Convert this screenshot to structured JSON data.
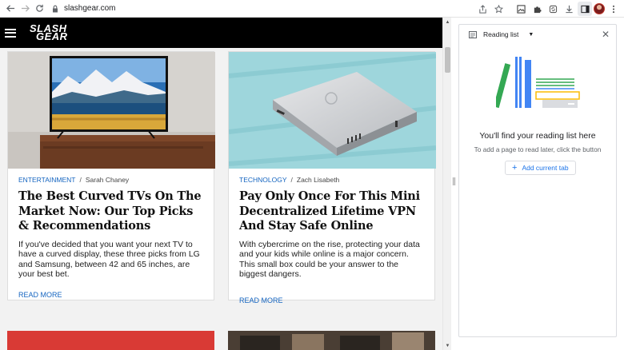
{
  "browser": {
    "url": "slashgear.com",
    "icons": [
      "back-arrow-icon",
      "forward-arrow-icon",
      "reload-icon",
      "lock-icon",
      "share-icon",
      "star-icon",
      "image-icon",
      "extensions-icon",
      "sync-icon",
      "download-icon",
      "side-panel-icon",
      "menu-dots-icon"
    ]
  },
  "site": {
    "logo_line1": "SLASH",
    "logo_line2": "GEAR",
    "cards": [
      {
        "category": "ENTERTAINMENT",
        "author": "Sarah Chaney",
        "title": "The Best Curved TVs On The Market Now: Our Top Picks & Recommendations",
        "excerpt": "If you've decided that you want your next TV to have a curved display, these three picks from LG and Samsung, between 42 and 65 inches, are your best bet.",
        "read_more": "READ MORE"
      },
      {
        "category": "TECHNOLOGY",
        "author": "Zach Lisabeth",
        "title": "Pay Only Once For This Mini Decentralized Lifetime VPN And Stay Safe Online",
        "excerpt": "With cybercrime on the rise, protecting your data and your kids while online is a major concern. This small box could be your answer to the biggest dangers.",
        "read_more": "READ MORE"
      }
    ],
    "separator": "/"
  },
  "panel": {
    "selector_label": "Reading list",
    "empty_title": "You'll find your reading list here",
    "empty_subtitle": "To add a page to read later, click the button",
    "add_button": "Add current tab"
  },
  "colors": {
    "link_blue": "#1565c0",
    "panel_blue": "#1a73e8",
    "header_black": "#000000"
  }
}
